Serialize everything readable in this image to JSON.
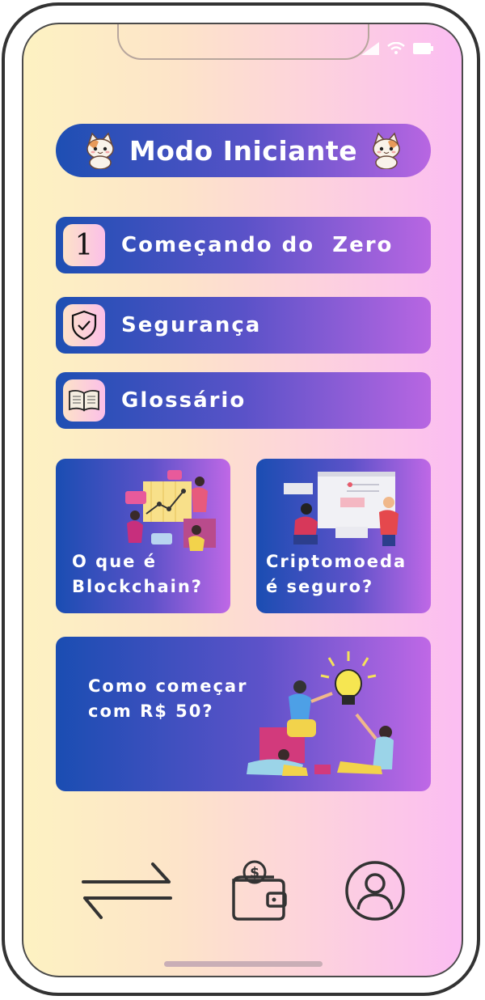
{
  "header": {
    "title": "Modo Iniciante",
    "left_icon": "cat-icon",
    "right_icon": "cat-icon"
  },
  "status_bar": {
    "icons": [
      "signal-icon",
      "wifi-icon",
      "battery-icon"
    ]
  },
  "menu": [
    {
      "label": "Começando do  Zero",
      "icon": "number-one-icon",
      "icon_text": "1"
    },
    {
      "label": "Segurança",
      "icon": "shield-check-icon"
    },
    {
      "label": "Glossário",
      "icon": "book-icon"
    }
  ],
  "cards": [
    {
      "line1": "O que é",
      "line2": "Blockchain?",
      "illustration": "team-chart-illustration"
    },
    {
      "line1": "Criptomoeda",
      "line2": "é seguro?",
      "illustration": "presentation-illustration"
    },
    {
      "line1": "Como começar",
      "line2": "com R$ 50?",
      "illustration": "idea-team-illustration"
    }
  ],
  "bottom_nav": [
    {
      "name": "transfer",
      "icon": "arrows-exchange-icon"
    },
    {
      "name": "wallet",
      "icon": "wallet-dollar-icon"
    },
    {
      "name": "profile",
      "icon": "user-circle-icon"
    }
  ],
  "colors": {
    "accent_start": "#1e4fb3",
    "accent_end": "#b866e2",
    "bg_start": "#fdf2c2",
    "bg_end": "#fbbdf2"
  }
}
